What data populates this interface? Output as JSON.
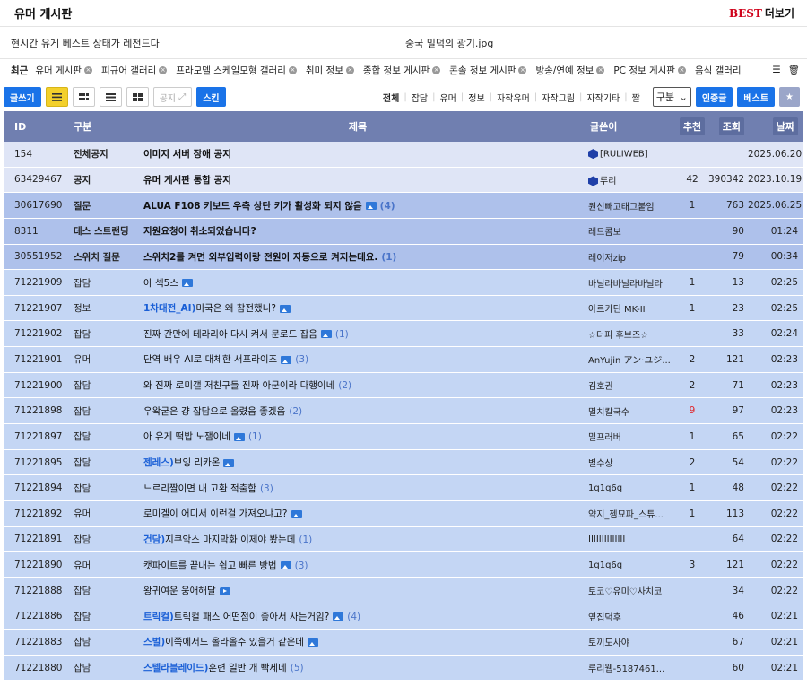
{
  "board": {
    "title": "유머 게시판",
    "best_label": "BEST",
    "more_label": "더보기"
  },
  "best_posts": [
    "현시간 유게 베스트 상태가 레전드다",
    "중국 밀덕의 광기.jpg"
  ],
  "recent": {
    "label": "최근",
    "chips": [
      "유머 게시판",
      "피규어 갤러리",
      "프라모델 스케일모형 갤러리",
      "취미 정보",
      "종합 정보 게시판",
      "콘솔 정보 게시판",
      "방송/연예 정보",
      "PC 정보 게시판",
      "음식 갤러리"
    ],
    "close_glyph": "×",
    "menu_glyph": "☰",
    "trash_glyph": "🗑"
  },
  "toolbar": {
    "write_label": "글쓰기",
    "notice_label": "공지",
    "skin_label": "스킨",
    "categories": [
      "전체",
      "잡담",
      "유머",
      "정보",
      "자작유머",
      "자작그림",
      "자작기타",
      "짤"
    ],
    "select_value": "구분",
    "certified_label": "인증글",
    "best_label": "베스트",
    "star_glyph": "★"
  },
  "columns": {
    "id": "ID",
    "category": "구분",
    "subject": "제목",
    "author": "글쓴이",
    "recommend": "추천",
    "views": "조회",
    "date": "날짜"
  },
  "rows": [
    {
      "type": "notice",
      "id": "154",
      "category": "전체공지",
      "subject": "이미지 서버 장애 공지",
      "author": "[RULIWEB]",
      "rec": "",
      "views": "",
      "date": "2025.06.20",
      "cube": true
    },
    {
      "type": "notice",
      "id": "63429467",
      "category": "공지",
      "subject": "유머 게시판 통합 공지",
      "author": "루리",
      "rec": "42",
      "views": "390342",
      "date": "2023.10.19",
      "cube": true
    },
    {
      "type": "qna",
      "id": "30617690",
      "category": "질문",
      "subject": "ALUA F108 키보드 우측 상단 키가 활성화 되지 않음",
      "img": true,
      "comments": "(4)",
      "author": "원신빼고태그붙임",
      "rec": "1",
      "views": "763",
      "date": "2025.06.25"
    },
    {
      "type": "qna",
      "id": "8311",
      "category": "데스 스트랜딩",
      "subject": "지원요청이 취소되었습니다?",
      "author": "레드콤보",
      "rec": "",
      "views": "90",
      "date": "01:24"
    },
    {
      "type": "qna",
      "id": "30551952",
      "category": "스위치 질문",
      "subject": "스위치2를 켜면 외부입력이랑 전원이 자동으로 켜지는데요.",
      "comments": "(1)",
      "author": "레이저zip",
      "rec": "",
      "views": "79",
      "date": "00:34"
    },
    {
      "type": "normal",
      "id": "71221909",
      "category": "잡담",
      "subject": "아 섹5스",
      "img": true,
      "author": "바닐라바닐라바닐라",
      "rec": "1",
      "views": "13",
      "date": "02:25"
    },
    {
      "type": "normal",
      "id": "71221907",
      "category": "정보",
      "tag": "1차대전_AI)",
      "subject": "미국은 왜 참전했니?",
      "img": true,
      "author": "아르카딘 MK-II",
      "rec": "1",
      "views": "23",
      "date": "02:25"
    },
    {
      "type": "normal",
      "id": "71221902",
      "category": "잡담",
      "subject": "진짜 간만에 테라리아 다시 켜서 문로드 잡음",
      "img": true,
      "comments": "(1)",
      "author": "☆더피 후브즈☆",
      "rec": "",
      "views": "33",
      "date": "02:24"
    },
    {
      "type": "normal",
      "id": "71221901",
      "category": "유머",
      "subject": "단역 배우 AI로 대체한 서프라이즈",
      "img": true,
      "comments": "(3)",
      "author": "AnYujin アン·ユジ...",
      "rec": "2",
      "views": "121",
      "date": "02:23"
    },
    {
      "type": "normal",
      "id": "71221900",
      "category": "잡담",
      "subject": "와 진짜 로미갤 저친구들 진짜 아군이라 다행이네",
      "comments": "(2)",
      "author": "김호권",
      "rec": "2",
      "views": "71",
      "date": "02:23"
    },
    {
      "type": "normal",
      "id": "71221898",
      "category": "잡담",
      "subject": "우왁굳은 걍 잡담으로 올렸음 좋겠음",
      "comments": "(2)",
      "author": "멸치칼국수",
      "rec": "9",
      "rec_red": true,
      "views": "97",
      "date": "02:23"
    },
    {
      "type": "normal",
      "id": "71221897",
      "category": "잡담",
      "subject": "아 유게 떡밥 노잼이네",
      "img": true,
      "comments": "(1)",
      "author": "밀프러버",
      "rec": "1",
      "views": "65",
      "date": "02:22"
    },
    {
      "type": "normal",
      "id": "71221895",
      "category": "잡담",
      "tag": "젠레스)",
      "subject": "보잉 리카온",
      "img": true,
      "author": "별수상",
      "rec": "2",
      "views": "54",
      "date": "02:22"
    },
    {
      "type": "normal",
      "id": "71221894",
      "category": "잡담",
      "subject": "느르리짤이면 내 고환 적출함",
      "comments": "(3)",
      "author": "1q1q6q",
      "rec": "1",
      "views": "48",
      "date": "02:22"
    },
    {
      "type": "normal",
      "id": "71221892",
      "category": "유머",
      "subject": "로미겔이 어디서 이런걸 가져오냐고?",
      "img": true,
      "author": "약지_젬묘파_스튜...",
      "rec": "1",
      "views": "113",
      "date": "02:22"
    },
    {
      "type": "normal",
      "id": "71221891",
      "category": "잡담",
      "tag": "건담)",
      "subject": "지쿠악스 마지막화 이제야 봤는데",
      "comments": "(1)",
      "author": "IIIIIIIIIIIIII",
      "rec": "",
      "views": "64",
      "date": "02:22"
    },
    {
      "type": "normal",
      "id": "71221890",
      "category": "유머",
      "subject": "캣파이트를 끝내는 쉽고 빠른 방법",
      "img": true,
      "comments": "(3)",
      "author": "1q1q6q",
      "rec": "3",
      "views": "121",
      "date": "02:22"
    },
    {
      "type": "normal",
      "id": "71221888",
      "category": "잡담",
      "subject": "왕귀여운 웅애해달",
      "vid": true,
      "author": "토코♡유미♡사치코",
      "rec": "",
      "views": "34",
      "date": "02:22"
    },
    {
      "type": "normal",
      "id": "71221886",
      "category": "잡담",
      "tag": "트릭컬)",
      "subject": "트릭컬 패스 어떤점이 좋아서 사는거임?",
      "img": true,
      "comments": "(4)",
      "author": "옆집덕후",
      "rec": "",
      "views": "46",
      "date": "02:21"
    },
    {
      "type": "normal",
      "id": "71221883",
      "category": "잡담",
      "tag": "스벌)",
      "subject": "이쪽에서도 올라올수 있을거 같은데",
      "img": true,
      "author": "토끼도사야",
      "rec": "",
      "views": "67",
      "date": "02:21"
    },
    {
      "type": "normal",
      "id": "71221880",
      "category": "잡담",
      "tag": "스텔라블레이드)",
      "subject": "훈련 일반 개 빡세네",
      "comments": "(5)",
      "author": "루리웹-5187461...",
      "rec": "",
      "views": "60",
      "date": "02:21"
    }
  ]
}
